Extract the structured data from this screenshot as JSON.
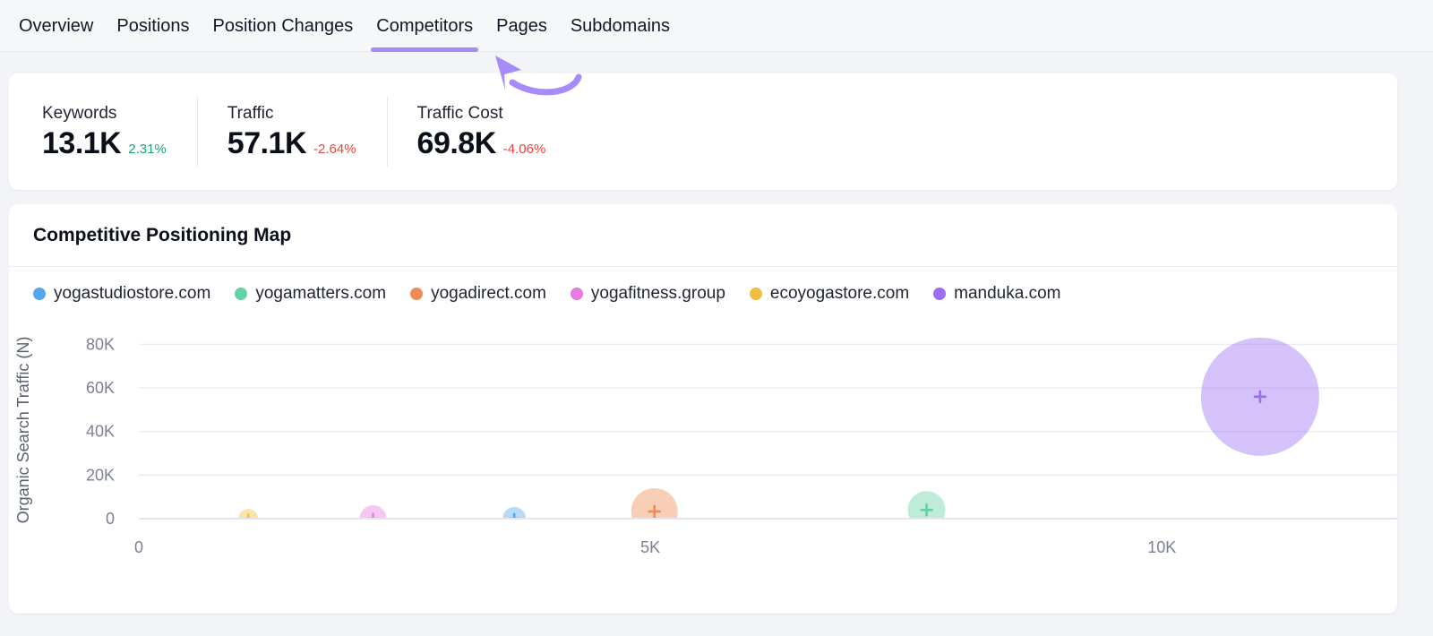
{
  "tabs": [
    {
      "label": "Overview",
      "active": false
    },
    {
      "label": "Positions",
      "active": false
    },
    {
      "label": "Position Changes",
      "active": false
    },
    {
      "label": "Competitors",
      "active": true
    },
    {
      "label": "Pages",
      "active": false
    },
    {
      "label": "Subdomains",
      "active": false
    }
  ],
  "annotation": {
    "type": "curved-arrow",
    "color": "#a78bfa",
    "points_to": "Competitors"
  },
  "metrics": [
    {
      "label": "Keywords",
      "value": "13.1K",
      "delta": "2.31%",
      "direction": "up"
    },
    {
      "label": "Traffic",
      "value": "57.1K",
      "delta": "-2.64%",
      "direction": "down"
    },
    {
      "label": "Traffic Cost",
      "value": "69.8K",
      "delta": "-4.06%",
      "direction": "down"
    }
  ],
  "colors": {
    "accent": "#a78bfa",
    "delta_up": "#17a673",
    "delta_down": "#e8453c",
    "page_bg": "#f2f4f7",
    "card_bg": "#ffffff",
    "grid": "#eceaf3"
  },
  "chart_card": {
    "title": "Competitive Positioning Map"
  },
  "chart_data": {
    "type": "scatter",
    "title": "Competitive Positioning Map",
    "xlabel": "",
    "ylabel": "Organic Search Traffic (N)",
    "xlim": [
      0,
      12300
    ],
    "ylim": [
      0,
      88000
    ],
    "xticks": [
      0,
      5000,
      10000
    ],
    "xticklabels": [
      "0",
      "5K",
      "10K"
    ],
    "yticks": [
      0,
      20000,
      40000,
      60000,
      80000
    ],
    "yticklabels": [
      "0",
      "20K",
      "40K",
      "60K",
      "80K"
    ],
    "grid": true,
    "legend_position": "top-left",
    "size_encodes": "traffic cost / bubble area",
    "marker": "plus-crosshair",
    "series": [
      {
        "name": "yogastudiostore.com",
        "color": "#54a7ec",
        "x": 3670,
        "y": 0,
        "r": 13
      },
      {
        "name": "yogamatters.com",
        "color": "#63d2a2",
        "x": 7700,
        "y": 4000,
        "r": 21
      },
      {
        "name": "yogadirect.com",
        "color": "#ef8b54",
        "x": 5040,
        "y": 3300,
        "r": 26
      },
      {
        "name": "yogafitness.group",
        "color": "#e879e0",
        "x": 2290,
        "y": 0,
        "r": 15
      },
      {
        "name": "ecoyogastore.com",
        "color": "#efbf41",
        "x": 1070,
        "y": 0,
        "r": 11
      },
      {
        "name": "manduka.com",
        "color": "#9b6ef3",
        "x": 10960,
        "y": 56000,
        "r": 66
      }
    ]
  }
}
